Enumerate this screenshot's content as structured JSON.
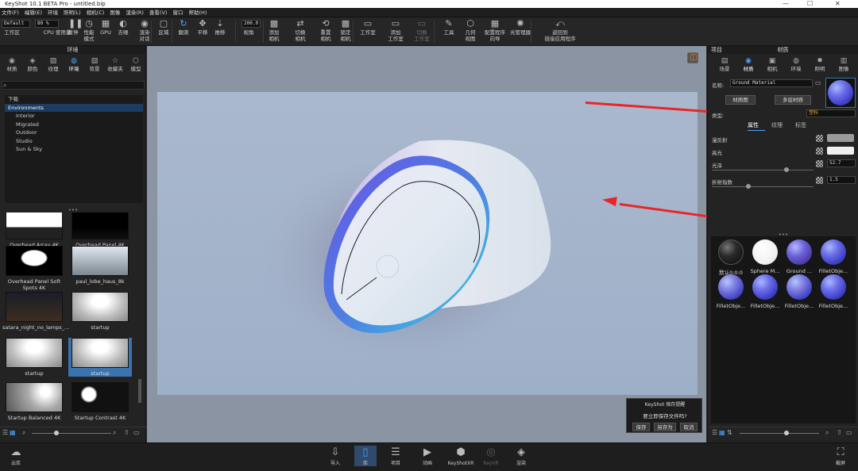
{
  "window": {
    "title": "KeyShot 10.1 BETA Pro  - untitled.bip",
    "min": "—",
    "max": "☐",
    "close": "✕"
  },
  "menu": [
    "文件(F)",
    "编辑(E)",
    "环境",
    "照明(L)",
    "相机(C)",
    "图像",
    "渲染(R)",
    "查看(V)",
    "窗口",
    "帮助(H)"
  ],
  "toolbar": {
    "workspace_value": "Default",
    "cpu_value": "80 %",
    "fov_value": "200.0",
    "items": [
      {
        "label": "工作区",
        "icon": "workspace-icon"
      },
      {
        "label": "CPU 使用量",
        "icon": "cpu-icon"
      },
      {
        "label": "暂停",
        "icon": "pause-icon"
      },
      {
        "label": "性能\n模式",
        "icon": "performance-icon"
      },
      {
        "label": "GPU",
        "icon": "gpu-icon"
      },
      {
        "label": "去噪",
        "icon": "denoise-icon"
      },
      {
        "label": "渲染\n对话",
        "icon": "render-dialog-icon"
      },
      {
        "label": "区域",
        "icon": "region-icon"
      },
      {
        "label": "翻滚",
        "icon": "tumble-icon"
      },
      {
        "label": "平移",
        "icon": "pan-icon"
      },
      {
        "label": "推移",
        "icon": "dolly-icon"
      },
      {
        "label": "视角",
        "icon": "perspective-icon"
      },
      {
        "label": "添加\n相机",
        "icon": "add-camera-icon"
      },
      {
        "label": "切换\n相机",
        "icon": "switch-camera-icon"
      },
      {
        "label": "重置\n相机",
        "icon": "reset-camera-icon"
      },
      {
        "label": "锁定\n相机",
        "icon": "lock-camera-icon"
      },
      {
        "label": "工作室",
        "icon": "studio-icon"
      },
      {
        "label": "添加\n工作室",
        "icon": "add-studio-icon"
      },
      {
        "label": "切换\n工作室",
        "icon": "switch-studio-icon"
      },
      {
        "label": "工具",
        "icon": "tools-icon"
      },
      {
        "label": "几何\n视图",
        "icon": "geometry-view-icon"
      },
      {
        "label": "配置程序\n向导",
        "icon": "configurator-icon"
      },
      {
        "label": "光管理器",
        "icon": "light-manager-icon"
      },
      {
        "label": "返回到\n链接应用程序",
        "icon": "return-link-icon"
      }
    ]
  },
  "left": {
    "header": "环境",
    "tabs": [
      {
        "label": "材质",
        "icon": "material-icon"
      },
      {
        "label": "颜色",
        "icon": "color-icon"
      },
      {
        "label": "纹理",
        "icon": "texture-icon"
      },
      {
        "label": "环境",
        "icon": "environment-icon"
      },
      {
        "label": "背景",
        "icon": "background-icon"
      },
      {
        "label": "收藏夹",
        "icon": "favorites-icon"
      },
      {
        "label": "模型",
        "icon": "model-icon"
      }
    ],
    "tree": [
      {
        "label": "下载",
        "indent": 0,
        "sel": false
      },
      {
        "label": "Environments",
        "indent": 0,
        "sel": true
      },
      {
        "label": "Interior",
        "indent": 1,
        "sel": false
      },
      {
        "label": "Migrated",
        "indent": 1,
        "sel": false
      },
      {
        "label": "Outdoor",
        "indent": 1,
        "sel": false
      },
      {
        "label": "Studio",
        "indent": 1,
        "sel": false
      },
      {
        "label": "Sun & Sky",
        "indent": 1,
        "sel": false
      }
    ],
    "thumbs": [
      "Overhead Array 4K",
      "Overhead Panel 4K",
      "Overhead Panel Soft Spots 4K",
      "paul_lobe_haus_8k",
      "satara_night_no_lamps_...",
      "startup",
      "startup",
      "startup",
      "Startup Balanced 4K",
      "Startup Contrast 4K"
    ],
    "more": "•••"
  },
  "right": {
    "tabs_header": {
      "left": "项目",
      "center": "材质"
    },
    "tabs": [
      {
        "label": "场景",
        "icon": "scene-icon"
      },
      {
        "label": "材质",
        "icon": "material-icon"
      },
      {
        "label": "相机",
        "icon": "camera-icon"
      },
      {
        "label": "环境",
        "icon": "environment-icon"
      },
      {
        "label": "照明",
        "icon": "lighting-icon"
      },
      {
        "label": "图像",
        "icon": "image-icon"
      }
    ],
    "name_label": "名称:",
    "name_value": "Ground Material",
    "btn_graph": "材质图",
    "btn_multi": "多层材质",
    "type_label": "类型:",
    "type_value": "塑料",
    "subtabs": [
      "属性",
      "纹理",
      "标签"
    ],
    "props": [
      {
        "label": "漫反射",
        "kind": "color",
        "color": "#9a9a9a"
      },
      {
        "label": "高光",
        "kind": "color",
        "color": "#f0f0f0"
      },
      {
        "label": "光泽",
        "kind": "value",
        "value": "52.7"
      },
      {
        "label": "折射指数",
        "kind": "value",
        "value": "1.5"
      }
    ],
    "materials": [
      {
        "label": "默认0:0:0",
        "ball": "b-black"
      },
      {
        "label": "Sphere M...",
        "ball": "b-white"
      },
      {
        "label": "Ground ...",
        "ball": "b-ground"
      },
      {
        "label": "FilletObje...",
        "ball": "b-blue"
      },
      {
        "label": "FilletObje...",
        "ball": "b-blue2"
      },
      {
        "label": "FilletObje...",
        "ball": "b-blue"
      },
      {
        "label": "FilletObje...",
        "ball": "b-blue2"
      },
      {
        "label": "FilletObje...",
        "ball": "b-blue"
      }
    ],
    "more": "•••"
  },
  "dialog": {
    "title": "KeyShot 保存提醒",
    "text": "要立即保存文件吗?",
    "save": "保存",
    "saveas": "另存为",
    "cancel": "取消"
  },
  "bottom": [
    {
      "label": "云库",
      "icon": "cloud-library-icon"
    },
    {
      "label": "导入",
      "icon": "import-icon"
    },
    {
      "label": "库",
      "icon": "library-icon"
    },
    {
      "label": "项目",
      "icon": "project-icon"
    },
    {
      "label": "动画",
      "icon": "animation-icon"
    },
    {
      "label": "KeyShotXR",
      "icon": "keyshotxr-icon"
    },
    {
      "label": "KeyVR",
      "icon": "keyvr-icon"
    },
    {
      "label": "渲染",
      "icon": "render-icon"
    },
    {
      "label": "截屏",
      "icon": "screenshot-icon"
    }
  ],
  "accent": "#4aa3ff",
  "annotation_color": "#e8262a"
}
